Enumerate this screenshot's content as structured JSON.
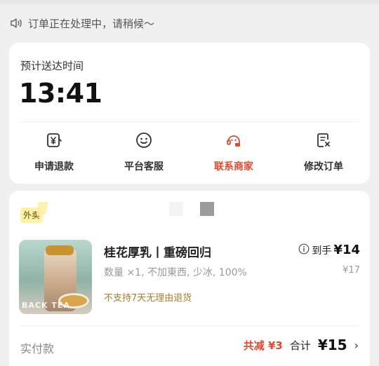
{
  "notice": {
    "text": "订单正在处理中，请稍候～",
    "icon": "speaker-icon"
  },
  "eta": {
    "label": "预计送达时间",
    "time": "13:41"
  },
  "actions": [
    {
      "label": "申请退款",
      "icon": "refund-icon"
    },
    {
      "label": "平台客服",
      "icon": "customer-service-icon"
    },
    {
      "label": "联系商家",
      "icon": "contact-merchant-icon",
      "accent": "#e04a2f"
    },
    {
      "label": "修改订单",
      "icon": "edit-order-icon"
    }
  ],
  "order": {
    "tag": "外卖",
    "product": {
      "name": "桂花厚乳丨重磅回归",
      "spec": "数量 ×1, 不加東西, 少冰, 100%",
      "note": "不支持7天无理由退货",
      "price_label": "到手",
      "price": "¥14",
      "original_price": "¥17",
      "image_text": "BACK TEA"
    },
    "payment": {
      "label": "实付款",
      "discount": "共减 ¥3",
      "total_label": "合计",
      "total": "¥15"
    }
  },
  "colors": {
    "accent": "#e04a2f",
    "note": "#a87c2d",
    "tag_bg": "#fff1a6"
  }
}
